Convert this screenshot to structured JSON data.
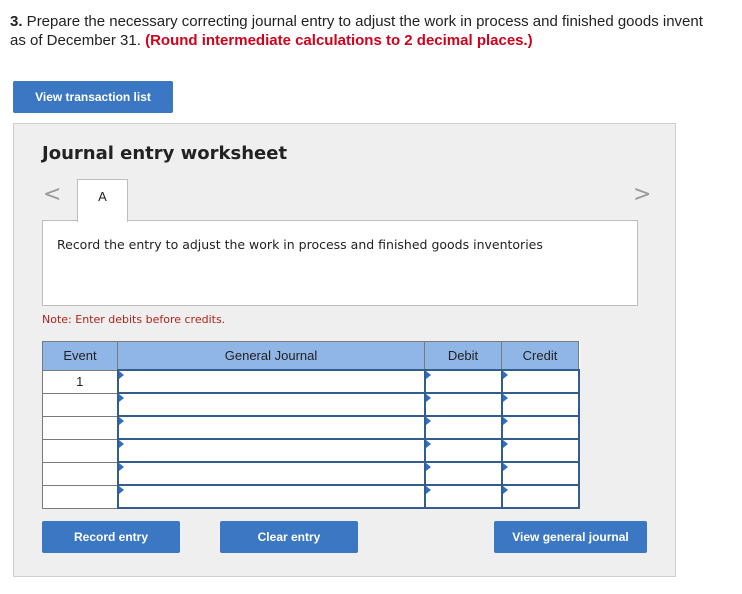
{
  "question": {
    "number": "3.",
    "text": " Prepare the necessary correcting journal entry to adjust the work in process and finished goods invent",
    "line2": "as of December 31. ",
    "warning": "(Round intermediate calculations to 2 decimal places.)"
  },
  "buttons": {
    "view_transactions": "View transaction list",
    "record_entry": "Record entry",
    "clear_entry": "Clear entry",
    "view_journal": "View general journal"
  },
  "worksheet": {
    "title": "Journal entry worksheet",
    "prev_arrow": "<",
    "next_arrow": ">",
    "tab": "A",
    "instruction": "Record the entry to adjust the work in process and finished goods inventories",
    "note": "Note: Enter debits before credits."
  },
  "table": {
    "headers": [
      "Event",
      "General Journal",
      "Debit",
      "Credit"
    ],
    "rows": [
      {
        "event": "1",
        "account": "",
        "debit": "",
        "credit": ""
      },
      {
        "event": "",
        "account": "",
        "debit": "",
        "credit": ""
      },
      {
        "event": "",
        "account": "",
        "debit": "",
        "credit": ""
      },
      {
        "event": "",
        "account": "",
        "debit": "",
        "credit": ""
      },
      {
        "event": "",
        "account": "",
        "debit": "",
        "credit": ""
      },
      {
        "event": "",
        "account": "",
        "debit": "",
        "credit": ""
      }
    ]
  },
  "colors": {
    "button_blue": "#3b77c2",
    "header_blue": "#8fb6e6",
    "warning_red": "#d0021b",
    "note_red": "#b0231b",
    "panel_gray": "#efefef"
  }
}
